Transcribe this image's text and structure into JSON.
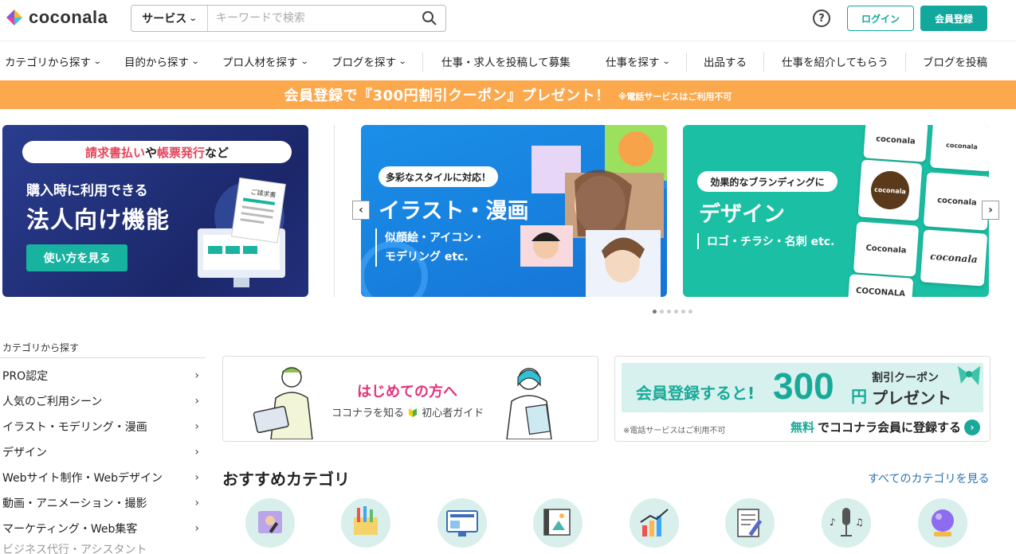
{
  "header": {
    "logo_text": "coconala",
    "search_category": "サービス",
    "search_placeholder": "キーワードで検索",
    "help_label": "?",
    "login_label": "ログイン",
    "signup_label": "会員登録"
  },
  "nav": {
    "items": [
      {
        "label": "カテゴリから探す",
        "dropdown": true
      },
      {
        "label": "目的から探す",
        "dropdown": true
      },
      {
        "label": "プロ人材を探す",
        "dropdown": true
      },
      {
        "label": "ブログを探す",
        "dropdown": true
      },
      {
        "label": "仕事・求人を投稿して募集",
        "dropdown": false
      },
      {
        "label": "仕事を探す",
        "dropdown": true
      },
      {
        "label": "出品する",
        "dropdown": false
      },
      {
        "label": "仕事を紹介してもらう",
        "dropdown": false
      },
      {
        "label": "ブログを投稿",
        "dropdown": false
      }
    ],
    "chevron": "⌄"
  },
  "promo": {
    "main": "会員登録で『300円割引クーポン』プレゼント！",
    "note": "※電話サービスはご利用不可"
  },
  "carousel": {
    "slide1": {
      "pill_red1": "請求書払い",
      "pill_mid": "や",
      "pill_red2": "帳票発行",
      "pill_end": "など",
      "sub": "購入時に利用できる",
      "title": "法人向け機能",
      "button": "使い方を見る",
      "doc_label": "ご請求書"
    },
    "slide2": {
      "pill": "多彩なスタイルに対応！",
      "title": "イラスト・漫画",
      "sub1": "似顔絵・アイコン・",
      "sub2": "モデリング etc."
    },
    "slide3": {
      "pill": "効果的なブランディングに",
      "title": "デザイン",
      "sub": "ロゴ・チラシ・名刺 etc.",
      "logo_words": [
        "coconala",
        "coconala",
        "coconala",
        "coconala",
        "Coconala",
        "coconala",
        "COCONALA"
      ]
    },
    "prev": "‹",
    "next": "›",
    "active_dot": 0,
    "dot_count": 6
  },
  "sidebar": {
    "title": "カテゴリから探す",
    "items": [
      "PRO認定",
      "人気のご利用シーン",
      "イラスト・モデリング・漫画",
      "デザイン",
      "Webサイト制作・Webデザイン",
      "動画・アニメーション・撮影",
      "マーケティング・Web集客",
      "ビジネス代行・アシスタント"
    ],
    "arrow": "›"
  },
  "guide_card": {
    "title": "はじめての方へ",
    "sub_a": "ココナラを知る",
    "sub_b": "初心者ガイド"
  },
  "coupon_card": {
    "line_a": "会員登録すると!",
    "number": "300",
    "yen": "円",
    "line_b": "割引クーポン",
    "line_c": "プレゼント",
    "note": "※電話サービスはご利用不可",
    "cta_a": "無料",
    "cta_b": "でココナラ会員に登録する",
    "cta_arrow": "›"
  },
  "recommended": {
    "title": "おすすめカテゴリ",
    "link": "すべてのカテゴリを見る"
  },
  "colors": {
    "brand": "#13a89e",
    "promo": "#fca84d",
    "pink": "#e3337a",
    "link": "#2a72b5"
  }
}
